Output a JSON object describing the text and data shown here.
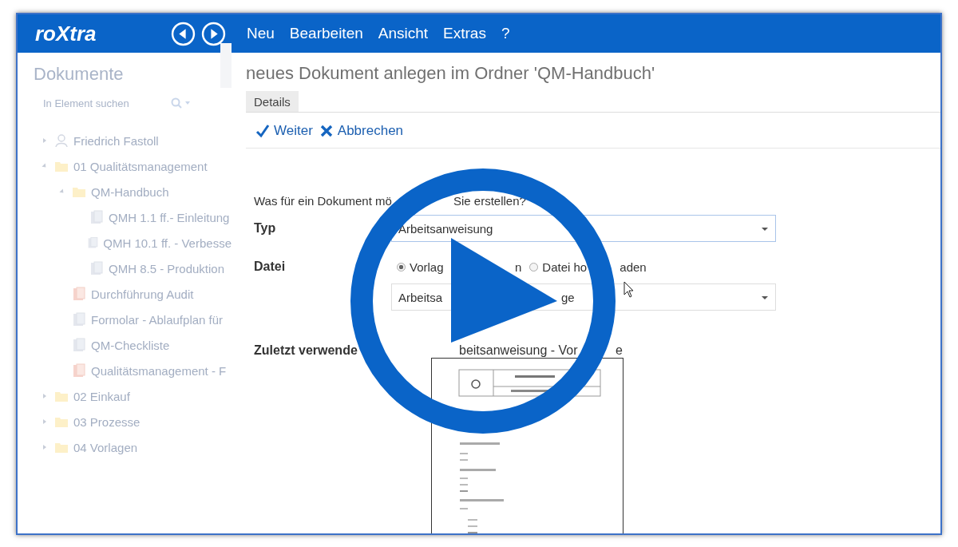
{
  "app": {
    "logo": "roXtra"
  },
  "menu": [
    "Neu",
    "Bearbeiten",
    "Ansicht",
    "Extras",
    "?"
  ],
  "sidebar": {
    "title": "Dokumente",
    "search": {
      "placeholder": "In Element suchen"
    },
    "tree": [
      {
        "kind": "user",
        "label": "Friedrich Fastoll",
        "expanded": false
      },
      {
        "kind": "folder",
        "label": "01 Qualitätsmanagement",
        "expanded": true,
        "children": [
          {
            "kind": "folder",
            "label": "QM-Handbuch",
            "expanded": true,
            "children": [
              {
                "kind": "file",
                "label": "QMH 1.1 ff.- Einleitung"
              },
              {
                "kind": "file",
                "label": "QMH 10.1 ff. - Verbesse"
              },
              {
                "kind": "file",
                "label": "QMH 8.5 - Produktion"
              }
            ]
          },
          {
            "kind": "report",
            "label": "Durchführung Audit"
          },
          {
            "kind": "file",
            "label": "Formolar - Ablaufplan für"
          },
          {
            "kind": "file",
            "label": "QM-Checkliste"
          },
          {
            "kind": "report",
            "label": "Qualitätsmanagement - F"
          }
        ]
      },
      {
        "kind": "folder",
        "label": "02 Einkauf",
        "expanded": false
      },
      {
        "kind": "folder",
        "label": "03 Prozesse",
        "expanded": false
      },
      {
        "kind": "folder",
        "label": "04 Vorlagen",
        "expanded": false
      }
    ]
  },
  "page": {
    "title": "neues Dokument anlegen im Ordner 'QM-Handbuch'",
    "tabs": [
      {
        "label": "Details",
        "selected": true
      }
    ],
    "actions": [
      {
        "kind": "confirm",
        "label": "Weiter"
      },
      {
        "kind": "cancel",
        "label": "Abbrechen"
      }
    ]
  },
  "form": {
    "question": [
      "Was für ein Dokument mö",
      "Sie erstellen?"
    ],
    "type": {
      "label": "Typ",
      "value": "Arbeitsanweisung"
    },
    "file": {
      "label": "Datei",
      "options": [
        {
          "label": [
            "Vorlag",
            "n"
          ],
          "selected": true
        },
        {
          "label": [
            "Datei ho",
            "aden"
          ],
          "selected": false
        }
      ],
      "template_value": [
        "Arbeitsa",
        "ge"
      ]
    },
    "recent": {
      "label": "Zuletzt verwende",
      "title": [
        "beitsanweisung - Vor",
        "e"
      ]
    }
  }
}
